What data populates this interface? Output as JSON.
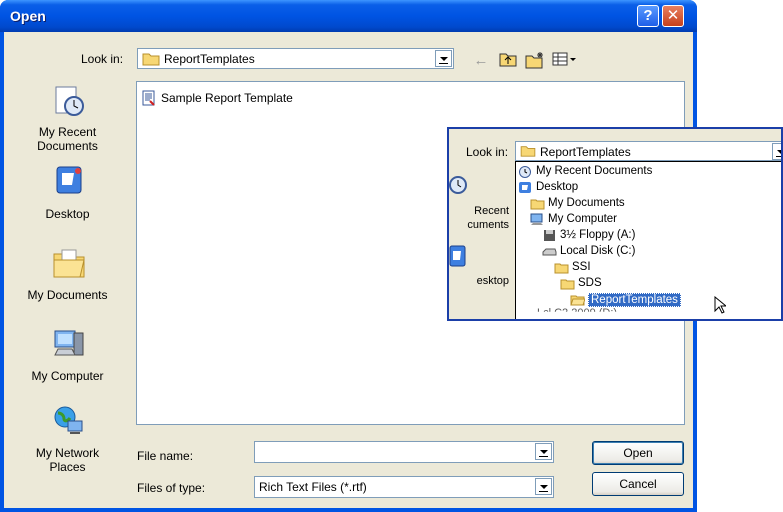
{
  "window": {
    "title": "Open",
    "help_glyph": "?",
    "close_glyph": "✕"
  },
  "lookin": {
    "label": "Look in:",
    "value": "ReportTemplates"
  },
  "toolbar": {
    "icons": [
      "back-icon",
      "up-folder-icon",
      "new-folder-icon",
      "views-menu-icon"
    ]
  },
  "places": [
    {
      "label": "My Recent\nDocuments",
      "icon": "recent-documents-icon"
    },
    {
      "label": "Desktop",
      "icon": "desktop-icon"
    },
    {
      "label": "My Documents",
      "icon": "my-documents-icon"
    },
    {
      "label": "My Computer",
      "icon": "my-computer-icon"
    },
    {
      "label": "My Network\nPlaces",
      "icon": "network-places-icon"
    }
  ],
  "files": [
    {
      "name": "Sample Report Template",
      "icon": "rtf-document-icon"
    }
  ],
  "filename": {
    "label": "File name:",
    "value": ""
  },
  "filetype": {
    "label": "Files of type:",
    "value": "Rich Text Files (*.rtf)"
  },
  "buttons": {
    "open": "Open",
    "cancel": "Cancel"
  },
  "inset": {
    "lookin_label": "Look in:",
    "combo_value": "ReportTemplates",
    "tree": [
      {
        "label": "My Recent Documents",
        "level": 0,
        "icon": "recent-documents-icon"
      },
      {
        "label": "Desktop",
        "level": 0,
        "icon": "desktop-icon"
      },
      {
        "label": "My Documents",
        "level": 1,
        "icon": "my-documents-icon"
      },
      {
        "label": "My Computer",
        "level": 1,
        "icon": "my-computer-icon"
      },
      {
        "label": "3½ Floppy (A:)",
        "level": 2,
        "icon": "floppy-icon"
      },
      {
        "label": "Local Disk (C:)",
        "level": 2,
        "icon": "disk-icon"
      },
      {
        "label": "SSI",
        "level": 3,
        "icon": "folder-icon"
      },
      {
        "label": "SDS",
        "level": 4,
        "icon": "folder-icon"
      },
      {
        "label": "ReportTemplates",
        "level": 5,
        "icon": "folder-open-icon",
        "selected": true
      }
    ],
    "left_labels": [
      "Recent",
      "cuments",
      "esktop"
    ],
    "cut_off_item": "Lcl C2 2009 (D:)"
  },
  "colors": {
    "titlebar": "#0054e3",
    "dialog_bg": "#ece9d8",
    "selection": "#316ac5",
    "border": "#7f9db9"
  }
}
